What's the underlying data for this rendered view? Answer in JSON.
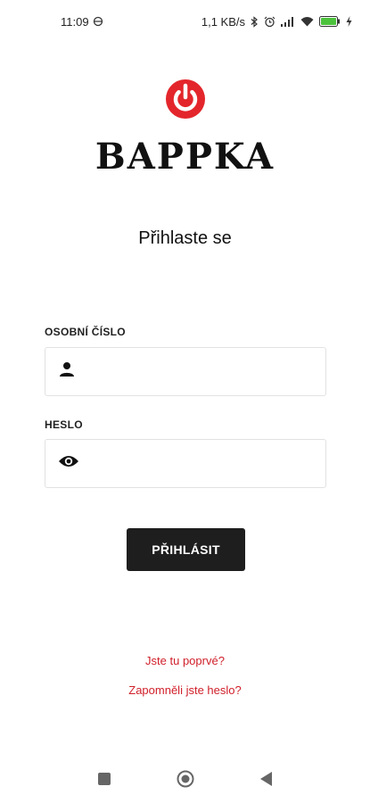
{
  "status_bar": {
    "time": "11:09",
    "net_speed": "1,1 KB/s",
    "icons": [
      "vpn-icon",
      "bluetooth-icon",
      "alarm-icon",
      "signal-icon",
      "wifi-icon",
      "battery-icon",
      "charging-icon"
    ]
  },
  "brand": {
    "name": "BAPPKA",
    "accent_color": "#e3262b"
  },
  "login": {
    "title": "Přihlaste se",
    "personal_number_label": "OSOBNÍ ČÍSLO",
    "personal_number_value": "",
    "password_label": "HESLO",
    "password_value": "",
    "submit_label": "PŘIHLÁSIT",
    "first_time_link": "Jste tu poprvé?",
    "forgot_password_link": "Zapomněli jste heslo?"
  },
  "nav_bar": {
    "icons": [
      "recents-icon",
      "home-icon",
      "back-icon"
    ]
  }
}
